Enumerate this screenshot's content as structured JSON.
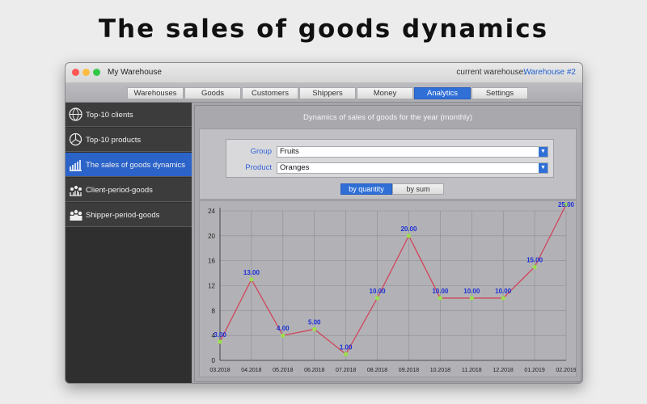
{
  "headline": "The sales of goods dynamics",
  "window": {
    "title": "My Warehouse",
    "warehouse_label": "current warehouse:",
    "warehouse_value": "Warehouse #2"
  },
  "tabs": [
    {
      "label": "Warehouses",
      "active": false
    },
    {
      "label": "Goods",
      "active": false
    },
    {
      "label": "Customers",
      "active": false
    },
    {
      "label": "Shippers",
      "active": false
    },
    {
      "label": "Money",
      "active": false
    },
    {
      "label": "Analytics",
      "active": true
    },
    {
      "label": "Settings",
      "active": false
    }
  ],
  "sidebar": {
    "items": [
      {
        "label": "Top-10 clients",
        "icon": "globe-users-icon",
        "selected": false
      },
      {
        "label": "Top-10 products",
        "icon": "pie-chart-icon",
        "selected": false
      },
      {
        "label": "The sales of goods dynamics",
        "icon": "bar-chart-icon",
        "selected": true
      },
      {
        "label": "Client-period-goods",
        "icon": "people-chart-icon",
        "selected": false
      },
      {
        "label": "Shipper-period-goods",
        "icon": "shipper-group-icon",
        "selected": false
      }
    ]
  },
  "content": {
    "title": "Dynamics of sales of goods for the year (monthly)",
    "filters": {
      "group_label": "Group",
      "group_value": "Fruits",
      "product_label": "Product",
      "product_value": "Oranges"
    },
    "segments": [
      {
        "label": "by quantity",
        "active": true
      },
      {
        "label": "by sum",
        "active": false
      }
    ]
  },
  "colors": {
    "accent": "#2f6fd6",
    "line": "#d0455b",
    "point": "#9be04a",
    "data_label": "#1a2fd6"
  },
  "chart_data": {
    "type": "line",
    "x": [
      "03.2018",
      "04.2018",
      "05.2018",
      "06.2018",
      "07.2018",
      "08.2018",
      "09.2018",
      "10.2018",
      "11.2018",
      "12.2018",
      "01.2019",
      "02.2019"
    ],
    "values": [
      3,
      13,
      4,
      5,
      1,
      10,
      20,
      10,
      10,
      10,
      15,
      25
    ],
    "data_labels": [
      "3.00",
      "13.00",
      "4.00",
      "5.00",
      "1.00",
      "10.00",
      "20.00",
      "10.00",
      "10.00",
      "10.00",
      "15.00",
      "25.00"
    ],
    "ylim": [
      0,
      24
    ],
    "yticks": [
      0,
      4,
      8,
      12,
      16,
      20,
      24
    ],
    "grid": true
  }
}
